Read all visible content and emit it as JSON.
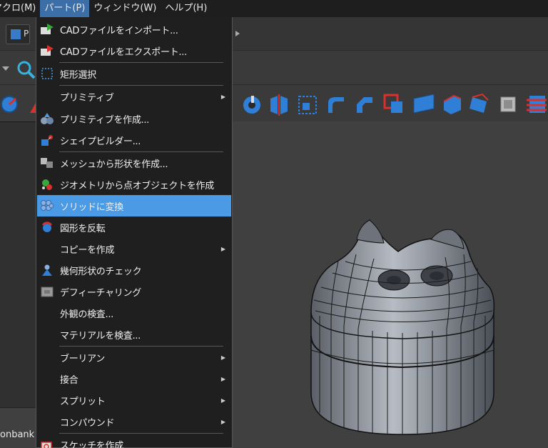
{
  "menubar": {
    "macro": "マクロ(M)",
    "part": "パート(P)",
    "window": "ウィンドウ(W)",
    "help": "ヘルプ(H)"
  },
  "toolbar": {
    "part_letter": "P"
  },
  "left_panel": {
    "bank_label": "onbank ("
  },
  "dropdown": {
    "items": [
      {
        "label": "CADファイルをインポート..."
      },
      {
        "label": "CADファイルをエクスポート..."
      },
      {
        "label": "矩形選択"
      },
      {
        "label": "プリミティブ"
      },
      {
        "label": "プリミティブを作成..."
      },
      {
        "label": "シェイプビルダー..."
      },
      {
        "label": "メッシュから形状を作成..."
      },
      {
        "label": "ジオメトリから点オブジェクトを作成"
      },
      {
        "label": "ソリッドに変換"
      },
      {
        "label": "図形を反転"
      },
      {
        "label": "コピーを作成"
      },
      {
        "label": "幾何形状のチェック"
      },
      {
        "label": "デフィーチャリング"
      },
      {
        "label": "外観の検査..."
      },
      {
        "label": "マテリアルを検査..."
      },
      {
        "label": "ブーリアン"
      },
      {
        "label": "接合"
      },
      {
        "label": "スプリット"
      },
      {
        "label": "コンパウンド"
      },
      {
        "label": "スケッチを作成"
      }
    ]
  },
  "colors": {
    "highlight": "#4a9ae6",
    "menu_active": "#3c6ea8",
    "accent_blue": "#2f7fd6",
    "accent_red": "#d9302c"
  }
}
